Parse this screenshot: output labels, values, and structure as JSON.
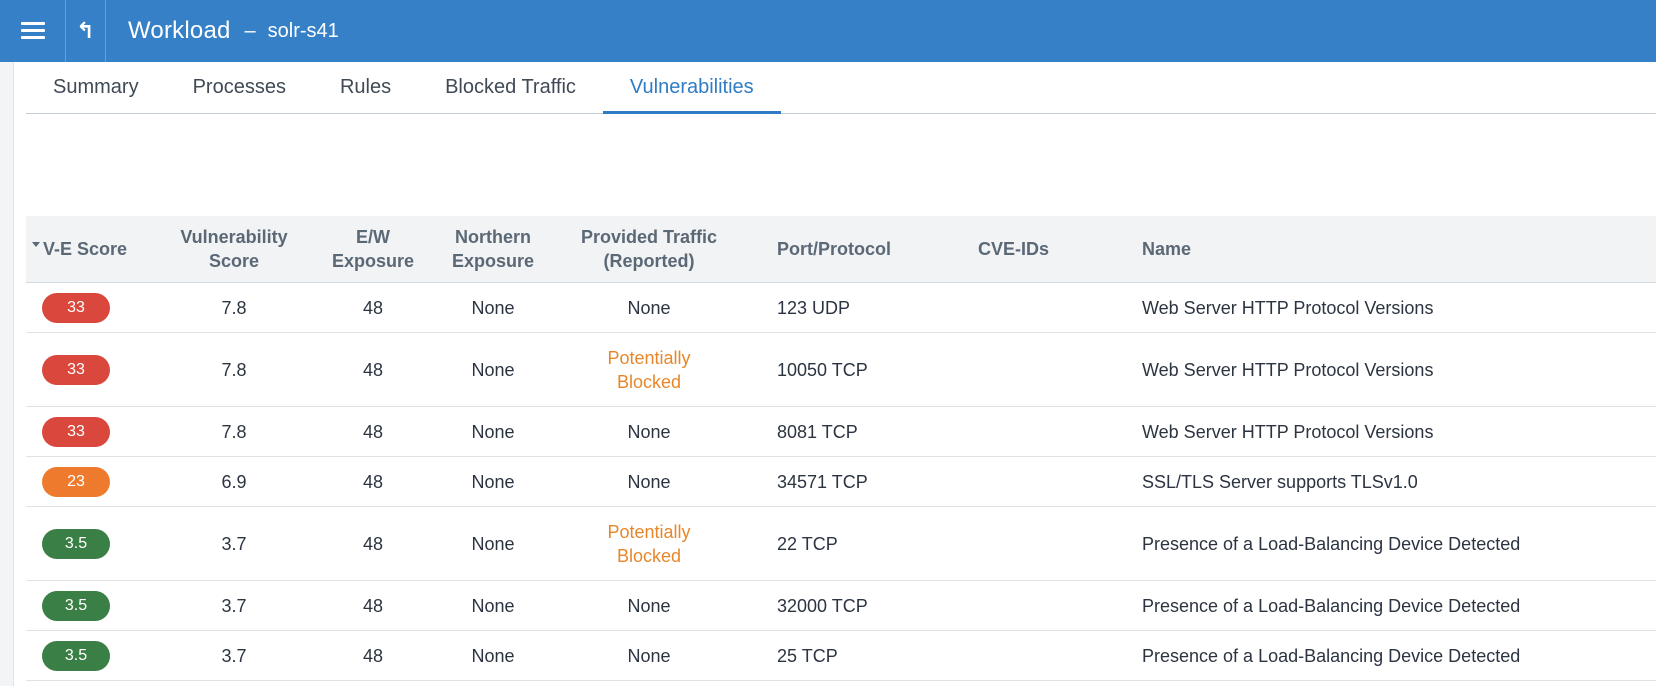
{
  "header": {
    "title": "Workload",
    "separator": "–",
    "subtitle": "solr-s41",
    "up_glyph": "↰"
  },
  "tabs": [
    {
      "label": "Summary",
      "active": false
    },
    {
      "label": "Processes",
      "active": false
    },
    {
      "label": "Rules",
      "active": false
    },
    {
      "label": "Blocked Traffic",
      "active": false
    },
    {
      "label": "Vulnerabilities",
      "active": true
    }
  ],
  "table": {
    "columns": {
      "ve_score": "V-E Score",
      "vuln_score": [
        "Vulnerability",
        "Score"
      ],
      "ew_exposure": [
        "E/W",
        "Exposure"
      ],
      "north_exposure": [
        "Northern",
        "Exposure"
      ],
      "provided_traffic": [
        "Provided Traffic",
        "(Reported)"
      ],
      "port_protocol": "Port/Protocol",
      "cve_ids": "CVE-IDs",
      "name": "Name"
    },
    "rows": [
      {
        "ve": "33",
        "ve_color": "#d9473d",
        "vs": "7.8",
        "ew": "48",
        "ne": "None",
        "pt": [
          "None"
        ],
        "pt_warn": false,
        "pp": "123 UDP",
        "cve": "",
        "name": "Web Server HTTP Protocol Versions"
      },
      {
        "ve": "33",
        "ve_color": "#d9473d",
        "vs": "7.8",
        "ew": "48",
        "ne": "None",
        "pt": [
          "Potentially",
          "Blocked"
        ],
        "pt_warn": true,
        "pp": "10050 TCP",
        "cve": "",
        "name": "Web Server HTTP Protocol Versions"
      },
      {
        "ve": "33",
        "ve_color": "#d9473d",
        "vs": "7.8",
        "ew": "48",
        "ne": "None",
        "pt": [
          "None"
        ],
        "pt_warn": false,
        "pp": "8081 TCP",
        "cve": "",
        "name": "Web Server HTTP Protocol Versions"
      },
      {
        "ve": "23",
        "ve_color": "#ee7a2e",
        "vs": "6.9",
        "ew": "48",
        "ne": "None",
        "pt": [
          "None"
        ],
        "pt_warn": false,
        "pp": "34571 TCP",
        "cve": "",
        "name": "SSL/TLS Server supports TLSv1.0"
      },
      {
        "ve": "3.5",
        "ve_color": "#3a7f45",
        "vs": "3.7",
        "ew": "48",
        "ne": "None",
        "pt": [
          "Potentially",
          "Blocked"
        ],
        "pt_warn": true,
        "pp": "22 TCP",
        "cve": "",
        "name": "Presence of a Load-Balancing Device Detected"
      },
      {
        "ve": "3.5",
        "ve_color": "#3a7f45",
        "vs": "3.7",
        "ew": "48",
        "ne": "None",
        "pt": [
          "None"
        ],
        "pt_warn": false,
        "pp": "32000 TCP",
        "cve": "",
        "name": "Presence of a Load-Balancing Device Detected"
      },
      {
        "ve": "3.5",
        "ve_color": "#3a7f45",
        "vs": "3.7",
        "ew": "48",
        "ne": "None",
        "pt": [
          "None"
        ],
        "pt_warn": false,
        "pp": "25 TCP",
        "cve": "",
        "name": "Presence of a Load-Balancing Device Detected"
      }
    ]
  },
  "colors": {
    "header_bg": "#3580c6",
    "active_tab": "#2f7cc4",
    "warning_text": "#e8872a"
  }
}
